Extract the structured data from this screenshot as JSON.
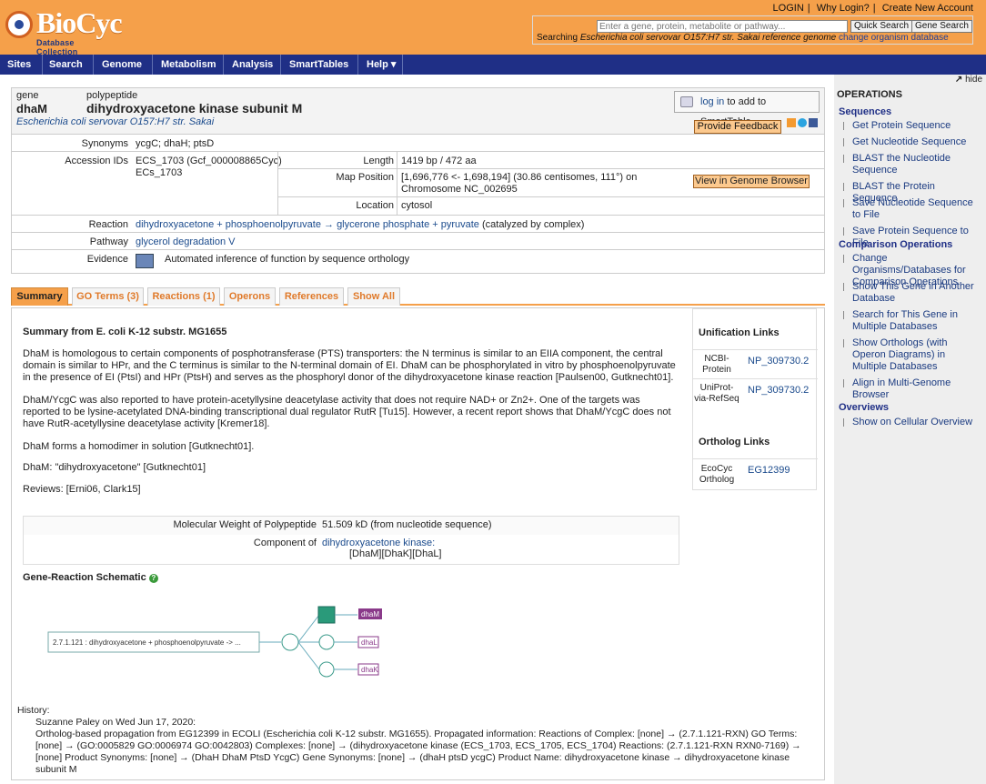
{
  "header": {
    "logo_text": "BioCyc",
    "logo_sub": "Database Collection",
    "top_links": [
      "LOGIN",
      "Why Login?",
      "Create New Account"
    ],
    "search_placeholder": "Enter a gene, protein, metabolite or pathway...",
    "quick_search": "Quick Search",
    "gene_search": "Gene Search",
    "searching_prefix": "Searching ",
    "searching_org": "Escherichia coli servovar O157:H7 str. Sakai reference genome",
    "change_org": "change organism database"
  },
  "nav": [
    "Sites",
    "Search",
    "Genome",
    "Metabolism",
    "Analysis",
    "SmartTables",
    "Help"
  ],
  "gene": {
    "gene_label": "gene",
    "gene_name": "dhaM",
    "poly_label": "polypeptide",
    "title": "dihydroxyacetone kinase subunit M",
    "organism": "Escherichia coli servovar O157:H7 str. Sakai",
    "smarttable_link": "log in",
    "smarttable_rest": " to add to SmartTable.",
    "feedback": "Provide Feedback"
  },
  "info": {
    "synonyms_label": "Synonyms",
    "synonyms": "ycgC; dhaH; ptsD",
    "accession_label": "Accession IDs",
    "accession_1": "ECS_1703 (Gcf_000008865Cyc)",
    "accession_2": "ECs_1703",
    "length_label": "Length",
    "length": "1419 bp / 472 aa",
    "mappos_label": "Map Position",
    "mappos_1": "[1,696,776 <- 1,698,194] (30.86 centisomes, 111°) on",
    "mappos_2": "Chromosome NC_002695",
    "genome_browser": "View in Genome Browser",
    "location_label": "Location",
    "location": "cytosol",
    "reaction_label": "Reaction",
    "reaction_link": "dihydroxyacetone + phosphoenolpyruvate → glycerone phosphate + pyruvate",
    "reaction_rest": " (catalyzed by complex)",
    "pathway_label": "Pathway",
    "pathway": "glycerol degradation V",
    "evidence_label": "Evidence",
    "evidence": "Automated inference of function by sequence orthology"
  },
  "tabs": [
    "Summary",
    "GO Terms (3)",
    "Reactions (1)",
    "Operons",
    "References",
    "Show All"
  ],
  "summary": {
    "title": "Summary from E. coli K-12 substr. MG1655",
    "p1": "DhaM is homologous to certain components of posphotransferase (PTS) transporters: the N terminus is similar to an EIIA component, the central domain is similar to HPr, and the C terminus is similar to the N-terminal domain of EI. DhaM can be phosphorylated in vitro by phosphoenolpyruvate in the presence of EI (PtsI) and HPr (PtsH) and serves as the phosphoryl donor of the dihydroxyacetone kinase reaction [Paulsen00, Gutknecht01].",
    "p2": "DhaM/YcgC was also reported to have protein-acetyllysine deacetylase activity that does not require NAD+ or Zn2+. One of the targets was reported to be lysine-acetylated DNA-binding transcriptional dual regulator RutR [Tu15]. However, a recent report shows that DhaM/YcgC does not have RutR-acetyllysine deacetylase activity [Kremer18].",
    "p3": "DhaM forms a homodimer in solution [Gutknecht01].",
    "p4": "DhaM: \"dihydroxyacetone\" [Gutknecht01]",
    "p5": "Reviews: [Erni06, Clark15]",
    "mw_label": "Molecular Weight of Polypeptide",
    "mw_value": "51.509 kD (from nucleotide sequence)",
    "comp_label": "Component of",
    "comp_link": "dihydroxyacetone kinase:",
    "comp_sub": "[DhaM][DhaK][DhaL]",
    "schematic_title": "Gene-Reaction Schematic",
    "schematic_reaction": "2.7.1.121 : dihydroxyacetone + phosphoenolpyruvate -> ...",
    "genes": [
      "dhaM",
      "dhaL",
      "dhaK"
    ]
  },
  "unification": {
    "title": "Unification Links",
    "ncbi_label": "NCBI-Protein",
    "ncbi_val": "NP_309730.2",
    "uniprot_label": "UniProt-via-RefSeq",
    "uniprot_val": "NP_309730.2",
    "ortholog_title": "Ortholog Links",
    "eco_label": "EcoCyc Ortholog",
    "eco_val": "EG12399"
  },
  "history": {
    "label": "History:",
    "line1": "Suzanne Paley on Wed Jun 17, 2020:",
    "line2": "Ortholog-based propagation from EG12399 in ECOLI (Escherichia coli K-12 substr. MG1655). Propagated information: Reactions of Complex: [none] → (2.7.1.121-RXN) GO Terms: [none] → (GO:0005829 GO:0006974 GO:0042803) Complexes: [none] → (dihydroxyacetone kinase (ECS_1703, ECS_1705, ECS_1704) Reactions: (2.7.1.121-RXN RXN0-7169) → [none] Product Synonyms: [none] → (DhaH DhaM PtsD YcgC) Gene Synonyms: [none] → (dhaH ptsD ycgC) Product Name: dihydroxyacetone kinase → dihydroxyacetone kinase subunit M"
  },
  "ops": {
    "hide": "hide",
    "title": "OPERATIONS",
    "sec1": "Sequences",
    "items1": [
      "Get Protein Sequence",
      "Get Nucleotide Sequence",
      "BLAST the Nucleotide Sequence",
      "BLAST the Protein Sequence",
      "Save Nucleotide Sequence to File",
      "Save Protein Sequence to File"
    ],
    "sec2": "Comparison Operations",
    "items2": [
      "Change Organisms/Databases for Comparison Operations",
      "Show This Gene in Another Database",
      "Search for This Gene in Multiple Databases",
      "Show Orthologs (with Operon Diagrams) in Multiple Databases",
      "Align in Multi-Genome Browser"
    ],
    "sec3": "Overviews",
    "items3": [
      "Show on Cellular Overview"
    ]
  }
}
